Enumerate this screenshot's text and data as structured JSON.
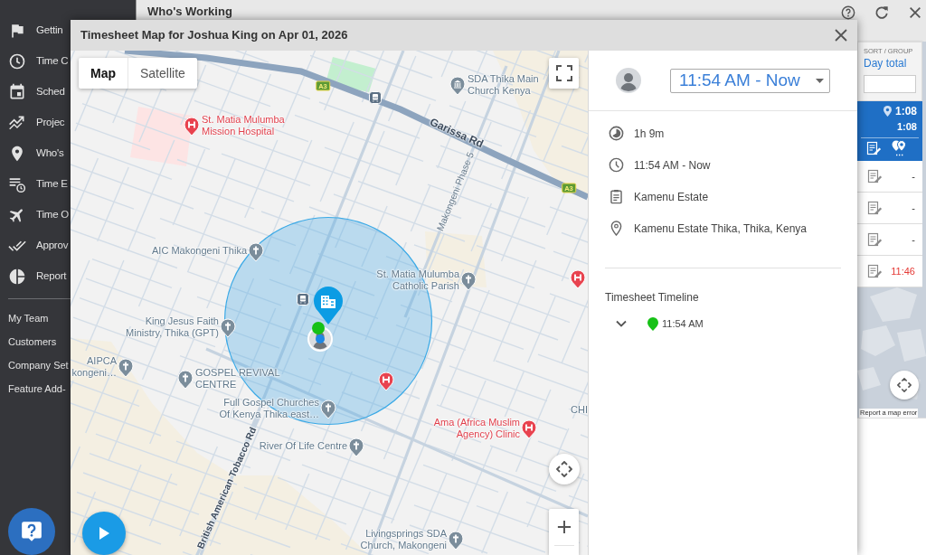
{
  "sidebar": {
    "nav_items": [
      {
        "label": "Gettin"
      },
      {
        "label": "Time C"
      },
      {
        "label": "Sched"
      },
      {
        "label": "Projec"
      },
      {
        "label": "Who's"
      },
      {
        "label": "Time E"
      },
      {
        "label": "Time O"
      },
      {
        "label": "Approv"
      },
      {
        "label": "Report"
      }
    ],
    "links": [
      {
        "label": "My Team"
      },
      {
        "label": "Customers"
      },
      {
        "label": "Company Set"
      },
      {
        "label": "Feature Add-"
      }
    ]
  },
  "background_window": {
    "title": "Who's Working",
    "sort": {
      "label": "SORT / GROUP",
      "value": "Day total"
    },
    "rows": [
      {
        "kind": "summary",
        "selected": true,
        "total": "1:08",
        "value": "1:08"
      },
      {
        "kind": "entry",
        "selected": false,
        "value": "-",
        "alert": false
      },
      {
        "kind": "entry",
        "selected": false,
        "value": "-",
        "alert": false
      },
      {
        "kind": "entry",
        "selected": false,
        "value": "-",
        "alert": false
      },
      {
        "kind": "entry",
        "selected": false,
        "value": "11:46",
        "alert": true
      }
    ],
    "map_link": "Report a map error"
  },
  "modal": {
    "title": "Timesheet Map for Joshua King on Apr 01, 2026",
    "map": {
      "map_types": [
        {
          "label": "Map",
          "selected": true
        },
        {
          "label": "Satellite",
          "selected": false
        }
      ],
      "route_shields": [
        {
          "label": "A3"
        },
        {
          "label": "A3"
        }
      ],
      "roads": [
        {
          "label": "Garissa Rd"
        },
        {
          "label": "Makongeni Phase 5"
        },
        {
          "label": "British American Tobacco Rd"
        }
      ],
      "places": [
        {
          "kind": "worship",
          "label": "SDA Thika Main Church Kenya"
        },
        {
          "kind": "transit"
        },
        {
          "kind": "hospital",
          "label": "St. Matia Mulumba Mission Hospital"
        },
        {
          "kind": "church",
          "label": "AIC Makongeni Thika"
        },
        {
          "kind": "church",
          "label": "St. Matia Mulumba Catholic Parish"
        },
        {
          "kind": "hospital"
        },
        {
          "kind": "transit"
        },
        {
          "kind": "church",
          "label": "King Jesus Faith Ministry, Thika (GPT)"
        },
        {
          "kind": "church",
          "label": "AIPCA kongeni…"
        },
        {
          "kind": "church",
          "label": "GOSPEL REVIVAL CENTRE"
        },
        {
          "kind": "hospital"
        },
        {
          "kind": "church",
          "label": "Full Gospel Churches Of Kenya Thika east…"
        },
        {
          "kind": "label",
          "label": "CHI"
        },
        {
          "kind": "hospital",
          "label": "Ama (Africa Muslim Agency) Clinic"
        },
        {
          "kind": "church",
          "label": "River Of Life Centre"
        },
        {
          "kind": "church",
          "label": "Livingsprings SDA Church, Makongeni"
        }
      ]
    },
    "details": {
      "time_range": "11:54 AM - Now",
      "items": [
        {
          "kind": "duration",
          "text": "1h 9m"
        },
        {
          "kind": "time",
          "text": "11:54 AM - Now"
        },
        {
          "kind": "job",
          "text": "Kamenu Estate"
        },
        {
          "kind": "location",
          "text": "Kamenu Estate Thika, Thika, Kenya"
        }
      ],
      "timeline": {
        "title": "Timesheet Timeline",
        "entries": [
          {
            "time": "11:54 AM",
            "color": "#16c116"
          }
        ]
      }
    }
  }
}
